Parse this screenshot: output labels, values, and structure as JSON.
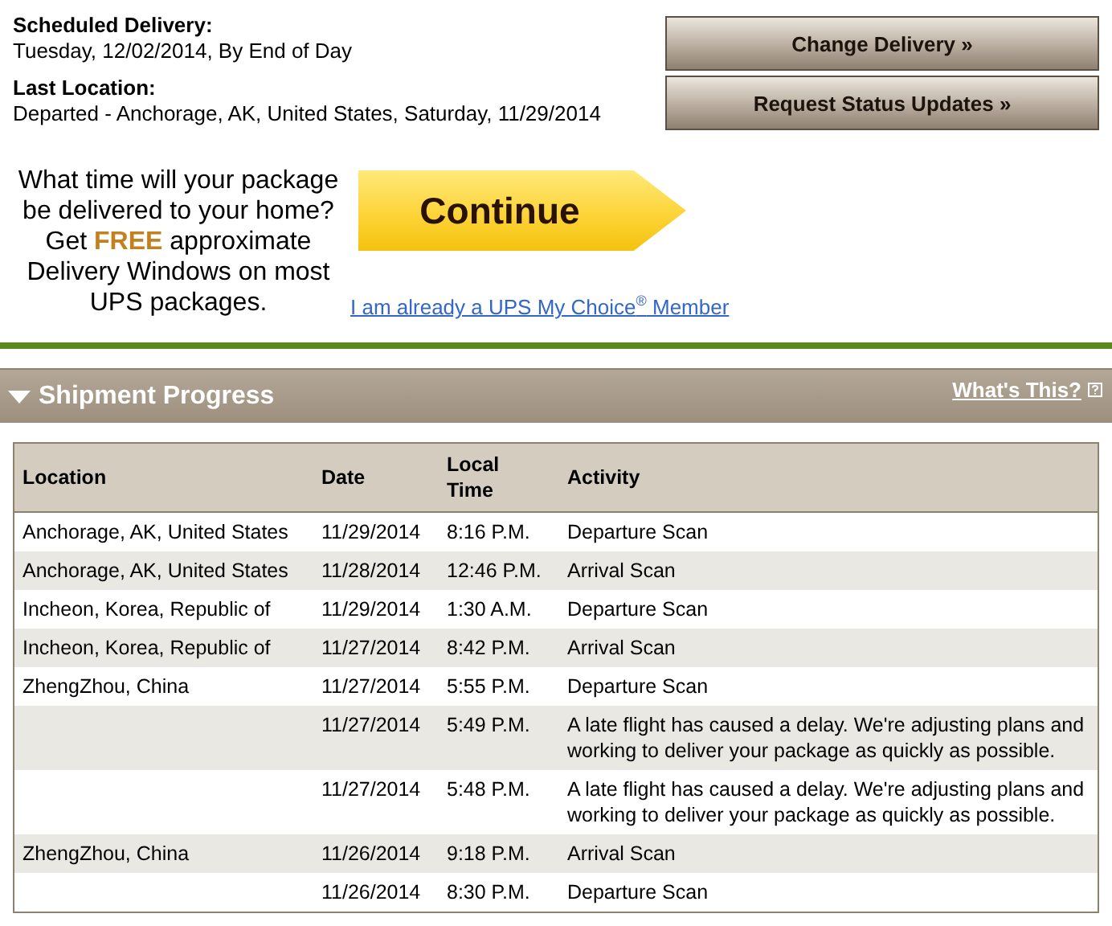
{
  "delivery": {
    "scheduled_label": "Scheduled Delivery:",
    "scheduled_value": "Tuesday, 12/02/2014, By End of Day",
    "last_label": "Last Location:",
    "last_value": "Departed - Anchorage, AK, United States, Saturday, 11/29/2014"
  },
  "actions": [
    "Change Delivery »",
    "Request Status Updates »"
  ],
  "promo": {
    "text": "What time will your package be delivered to your home? Get **FREE** approximate Delivery Windows on most UPS packages.",
    "button": "Continue",
    "link": "I am already a UPS My Choice$^{®}$ Member"
  },
  "section": {
    "title": "Shipment Progress",
    "expanded": true,
    "help_link": "What's This?"
  },
  "table": {
    "columns": [
      "Location",
      "Date",
      "Local Time",
      "Activity"
    ],
    "rows": [
      {
        "location": "Anchorage, AK, United States",
        "date": "11/29/2014",
        "time": "8:16 P.M.",
        "activity": "Departure Scan"
      },
      {
        "location": "Anchorage, AK, United States",
        "date": "11/28/2014",
        "time": "12:46 P.M.",
        "activity": "Arrival Scan"
      },
      {
        "location": "Incheon, Korea, Republic of",
        "date": "11/29/2014",
        "time": "1:30 A.M.",
        "activity": "Departure Scan"
      },
      {
        "location": "Incheon, Korea, Republic of",
        "date": "11/27/2014",
        "time": "8:42 P.M.",
        "activity": "Arrival Scan"
      },
      {
        "location": "ZhengZhou, China",
        "date": "11/27/2014",
        "time": "5:55 P.M.",
        "activity": "Departure Scan"
      },
      {
        "date": "11/27/2014",
        "time": "5:49 P.M.",
        "activity": "A late flight has caused a delay. We're adjusting plans and working to deliver your package as quickly as possible."
      },
      {
        "date": "11/27/2014",
        "time": "5:48 P.M.",
        "activity": "A late flight has caused a delay. We're adjusting plans and working to deliver your package as quickly as possible."
      },
      {
        "location": "ZhengZhou, China",
        "date": "11/26/2014",
        "time": "9:18 P.M.",
        "activity": "Arrival Scan"
      },
      {
        "date": "11/26/2014",
        "time": "8:30 P.M.",
        "activity": "Departure Scan"
      }
    ]
  }
}
